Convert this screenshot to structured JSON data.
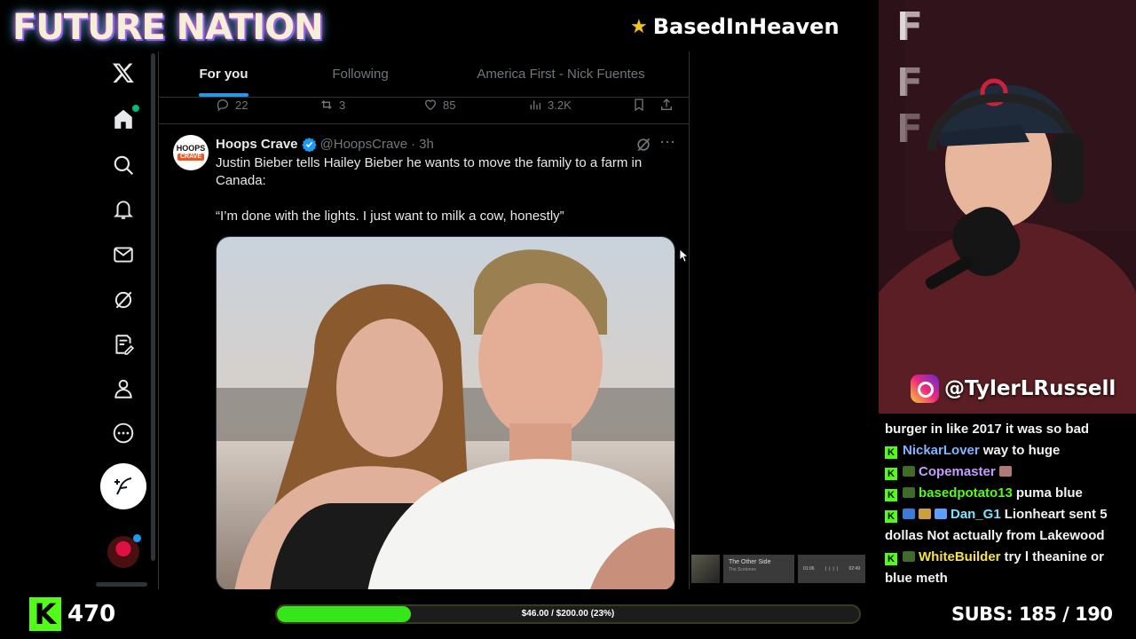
{
  "banner": {
    "title": "FUTURE NATION",
    "user": "BasedInHeaven"
  },
  "tabs": [
    {
      "label": "For you",
      "active": true
    },
    {
      "label": "Following",
      "active": false
    },
    {
      "label": "America First - Nick Fuentes",
      "active": false
    }
  ],
  "prev_tweet_actions": {
    "replies": "22",
    "reposts": "3",
    "likes": "85",
    "views": "3.2K"
  },
  "tweet": {
    "avatar_line1": "HOOPS",
    "avatar_line2": "CRAVE",
    "author_name": "Hoops Crave",
    "handle": "@HoopsCrave",
    "separator": "·",
    "time": "3h",
    "text_paragraph1": "Justin Bieber tells Hailey Bieber he wants to move the family to a farm in Canada:",
    "text_paragraph2": "“I’m done with the lights. I just want to milk a cow, honestly”",
    "more_icon": "more-dots-icon"
  },
  "music": {
    "title": "The Other Side",
    "artist": "The Scotones",
    "elapsed": "01:06",
    "total": "02:49"
  },
  "instagram_handle": "@TylerLRussell",
  "chat": [
    {
      "user": "",
      "message": "burger in like 2017 it was so bad",
      "user_color": "#ffffff"
    },
    {
      "user": "NickarLover",
      "message": "way to huge",
      "user_color": "#7fb4ff"
    },
    {
      "user": "Copemaster",
      "message": "",
      "user_color": "#c79bff"
    },
    {
      "user": "basedpotato13",
      "message": "puma blue",
      "user_color": "#53fc18"
    },
    {
      "user": "Dan_G1",
      "message": "Lionheart sent 5 dollas Not actually from Lakewood",
      "user_color": "#7fe0ff"
    },
    {
      "user": "WhiteBuilder",
      "message": "try l theanine or blue meth",
      "user_color": "#f5e14a"
    }
  ],
  "bottom": {
    "followers": "470",
    "goal_text": "$46.00 / $200.00 (23%)",
    "goal_fraction": 0.23,
    "subs_label": "SUBS:",
    "subs_value": "185 / 190"
  },
  "colors": {
    "accent": "#1d9bf0",
    "kick_green": "#53fc18",
    "goal_green": "#35e61a"
  }
}
